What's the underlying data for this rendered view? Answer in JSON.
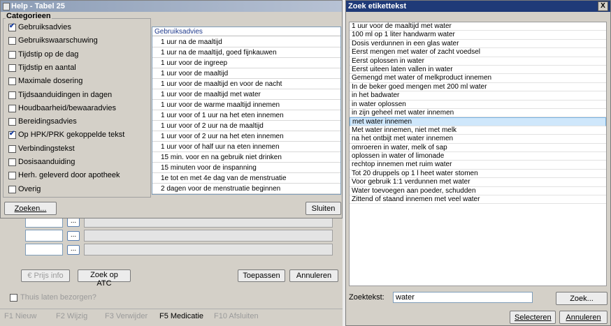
{
  "help_dialog": {
    "title": "Help - Tabel 25",
    "categories_legend": "Categorieen",
    "categories": [
      {
        "label": "Gebruiksadvies",
        "checked": true
      },
      {
        "label": "Gebruikswaarschuwing",
        "checked": false
      },
      {
        "label": "Tijdstip op de dag",
        "checked": false
      },
      {
        "label": "Tijdstip en aantal",
        "checked": false
      },
      {
        "label": "Maximale dosering",
        "checked": false
      },
      {
        "label": "Tijdsaanduidingen in dagen",
        "checked": false
      },
      {
        "label": "Houdbaarheid/bewaaradvies",
        "checked": false
      },
      {
        "label": "Bereidingsadvies",
        "checked": false
      },
      {
        "label": "Op HPK/PRK gekoppelde tekst",
        "checked": true
      },
      {
        "label": "Verbindingstekst",
        "checked": false
      },
      {
        "label": "Dosisaanduiding",
        "checked": false
      },
      {
        "label": "Herh. geleverd door apotheek",
        "checked": false
      },
      {
        "label": "Overig",
        "checked": false
      }
    ],
    "list_header": "Gebruiksadvies",
    "list_items": [
      "1 uur na de maaltijd",
      "1 uur na de maaltijd, goed fijnkauwen",
      "1 uur voor de ingreep",
      "1 uur voor de maaltijd",
      "1 uur voor de maaltijd en voor de nacht",
      "1 uur voor de maaltijd met water",
      "1 uur voor de warme maaltijd innemen",
      "1 uur voor of 1 uur na het eten innemen",
      "1 uur voor of 2 uur na de maaltijd",
      "1 uur voor of 2 uur na het eten innemen",
      "1 uur voor of half uur na eten innemen",
      "15 min. voor en na gebruik niet drinken",
      "15 minuten voor de inspanning",
      "1e tot en met 4e dag van de menstruatie",
      "2 dagen voor de menstruatie beginnen"
    ],
    "zoeken_button": "Zoeken...",
    "sluiten_button": "Sluiten"
  },
  "background_form": {
    "small_button": "...",
    "prijs_info_button": "€ Prijs info",
    "zoek_atc_button": "Zoek op ATC",
    "toepassen_button": "Toepassen",
    "annuleren_button": "Annuleren",
    "thuis_checkbox": "Thuis laten bezorgen?",
    "function_keys": [
      "F1 Nieuw",
      "F2 Wijzig",
      "F3 Verwijder",
      "F5 Medicatie",
      "F10 Afsluiten"
    ]
  },
  "search_dialog": {
    "title": "Zoek etikettekst",
    "close_symbol": "X",
    "results": [
      "1 uur voor de maaltijd met water",
      "100 ml op 1 liter handwarm water",
      "Dosis verdunnen in een glas water",
      "Eerst mengen met water of zacht voedsel",
      "Eerst oplossen in water",
      "Eerst uiteen laten vallen in water",
      "Gemengd met water of melkproduct innemen",
      "In de beker goed mengen met 200 ml water",
      "in het badwater",
      "in water oplossen",
      "in zijn geheel met water innemen",
      "met water innemen",
      "Met water innemen, niet met melk",
      "na het ontbijt met water innemen",
      "omroeren in water, melk of sap",
      "oplossen in water of limonade",
      "rechtop innemen met ruim water",
      "Tot 20 druppels op 1 l heet water stomen",
      "Voor gebruik 1:1 verdunnen met water",
      "Water toevoegen aan poeder, schudden",
      "Zittend of staand innemen met veel water"
    ],
    "selected_index": 11,
    "search_label": "Zoektekst:",
    "search_value": "water",
    "zoek_button": "Zoek...",
    "selecteren_button": "Selecteren",
    "annuleren_button": "Annuleren"
  }
}
